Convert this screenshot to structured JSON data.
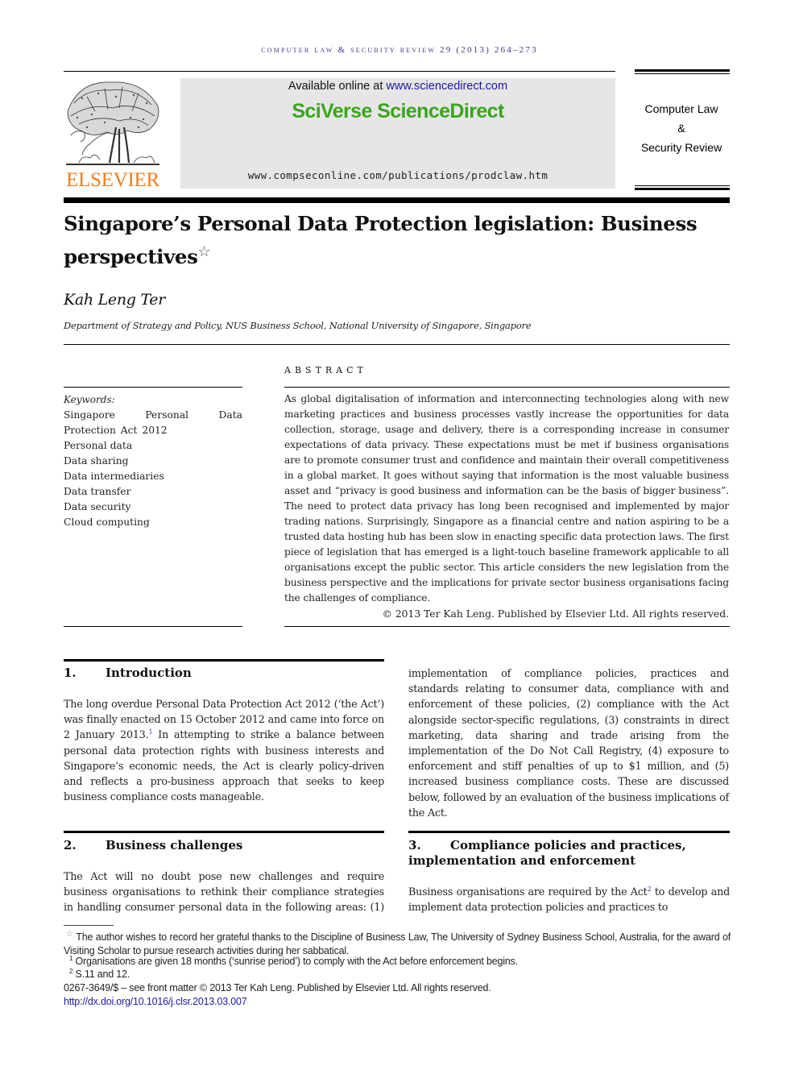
{
  "running_head": "COMPUTER LAW & SECURITY REVIEW 29 (2013) 264–273",
  "header": {
    "publisher_logo": "ELSEVIER",
    "available_online_prefix": "Available online at ",
    "available_online_link": "www.sciencedirect.com",
    "platform_name": "SciVerse ScienceDirect",
    "journal_url": "www.compseconline.com/publications/prodclaw.htm",
    "journal_name_line1": "Computer Law",
    "journal_name_line2": "&",
    "journal_name_line3": "Security Review"
  },
  "article": {
    "title": "Singapore’s Personal Data Protection legislation: Business perspectives",
    "title_note_marker": "☆",
    "author": "Kah Leng Ter",
    "affiliation": "Department of Strategy and Policy, NUS Business School, National University of Singapore, Singapore"
  },
  "keywords": {
    "label": "Keywords:",
    "items": [
      "Singapore Personal Data Protection Act 2012",
      "Personal data",
      "Data sharing",
      "Data intermediaries",
      "Data transfer",
      "Data security",
      "Cloud computing"
    ]
  },
  "abstract": {
    "heading": "ABSTRACT",
    "text": "As global digitalisation of information and interconnecting technologies along with new marketing practices and business processes vastly increase the opportunities for data collection, storage, usage and delivery, there is a corresponding increase in consumer expectations of data privacy. These expectations must be met if business organisations are to promote consumer trust and confidence and maintain their overall competitiveness in a global market. It goes without saying that information is the most valuable business asset and “privacy is good business and information can be the basis of bigger business”. The need to protect data privacy has long been recognised and implemented by major trading nations. Surprisingly, Singapore as a financial centre and nation aspiring to be a trusted data hosting hub has been slow in enacting specific data protection laws. The first piece of legislation that has emerged is a light-touch baseline framework applicable to all organisations except the public sector. This article considers the new legislation from the business perspective and the implications for private sector business organisations facing the challenges of compliance.",
    "copyright": "© 2013 Ter Kah Leng. Published by Elsevier Ltd. All rights reserved."
  },
  "sections": [
    {
      "number": "1.",
      "title": "Introduction",
      "text_before_note": "The long overdue Personal Data Protection Act 2012 (‘the Act’) was finally enacted on 15 October 2012 and came into force on 2 January 2013.",
      "note_ref": "1",
      "text_after_note": " In attempting to strike a balance between personal data protection rights with business interests and Singapore’s economic needs, the Act is clearly policy-driven and reflects a pro-business approach that seeks to keep business compliance costs manageable."
    },
    {
      "number": "2.",
      "title": "Business challenges",
      "text": "The Act will no doubt pose new challenges and require business organisations to rethink their compliance strategies in handling consumer personal data in the following areas: (1)",
      "continuation": "implementation of compliance policies, practices and standards relating to consumer data, compliance with and enforcement of these policies, (2) compliance with the Act alongside sector-specific regulations, (3) constraints in direct marketing, data sharing and trade arising from the implementation of the Do Not Call Registry, (4) exposure to enforcement and stiff penalties of up to $1 million, and (5) increased business compliance costs. These are discussed below, followed by an evaluation of the business implications of the Act."
    },
    {
      "number": "3.",
      "title": "Compliance policies and practices, implementation and enforcement",
      "text_before_note": "Business organisations are required by the Act",
      "note_ref": "2",
      "text_after_note": " to develop and implement data protection policies and practices to"
    }
  ],
  "footnotes": {
    "star_marker": "☆",
    "star_text": " The author wishes to record her grateful thanks to the Discipline of Business Law, The University of Sydney Business School, Australia, for the award of Visiting Scholar to pursue research activities during her sabbatical.",
    "notes": [
      {
        "marker": "1",
        "text": " Organisations are given 18 months (‘sunrise period’) to comply with the Act before enforcement begins."
      },
      {
        "marker": "2",
        "text": " S.11 and 12."
      }
    ],
    "front_matter": "0267-3649/$ – see front matter © 2013 Ter Kah Leng. Published by Elsevier Ltd. All rights reserved.",
    "doi": "http://dx.doi.org/10.1016/j.clsr.2013.03.007"
  },
  "colors": {
    "running_head": "#3a3a8c",
    "elsevier_orange": "#f07c1d",
    "sciencedirect_green": "#3aa51c",
    "link_blue": "#1c1ca0",
    "header_box_gray": "#e6e6e6"
  }
}
